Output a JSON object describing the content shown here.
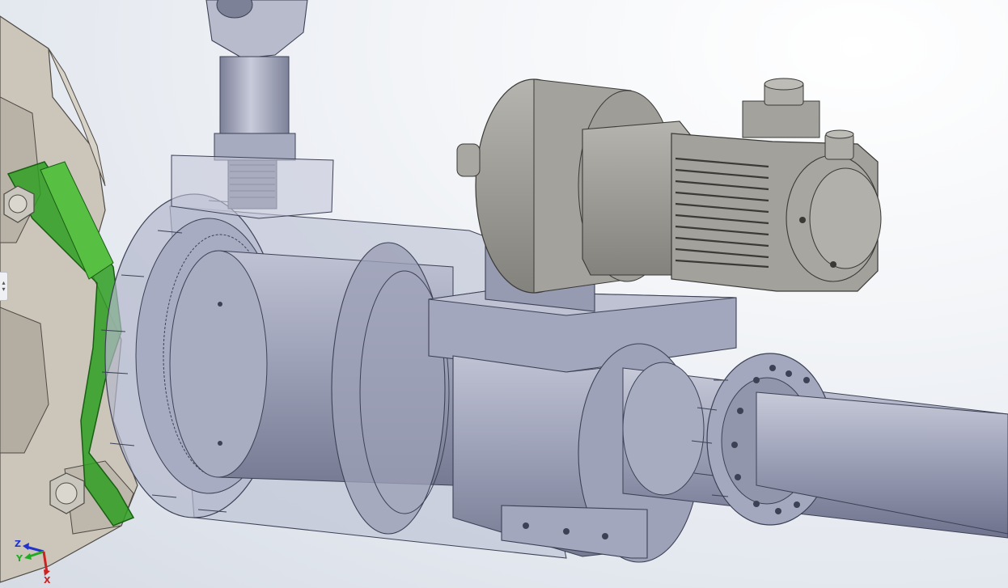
{
  "viewport": {
    "background_top": "#ffffff",
    "background_bottom": "#d6dbe4",
    "pane_handle_glyph_up": "▴",
    "pane_handle_glyph_down": "▾"
  },
  "model": {
    "part_colors": {
      "steel": "#9ea3b8",
      "housing_transparent": "#b6bbd0",
      "motor_body": "#9a9a96",
      "linkage_green": "#2a9a1e",
      "frame_beige": "#c9c3b8"
    }
  },
  "triad": {
    "z_label": "Z",
    "y_label": "Y",
    "x_label": "X",
    "z_color": "#2233cc",
    "y_color": "#22aa22",
    "x_color": "#cc2222"
  }
}
